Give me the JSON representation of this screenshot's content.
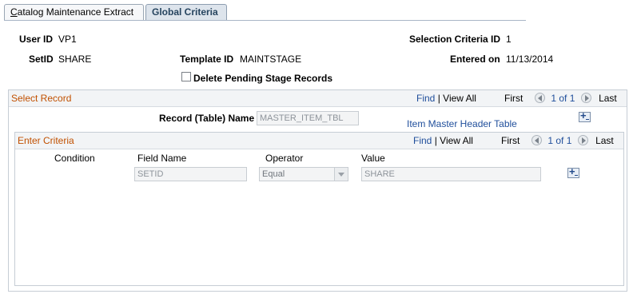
{
  "tabs": [
    {
      "label": "Catalog Maintenance Extract",
      "underline": "C",
      "active": false
    },
    {
      "label": "Global Criteria",
      "active": true
    }
  ],
  "header": {
    "user_id_label": "User ID",
    "user_id_value": "VP1",
    "setid_label": "SetID",
    "setid_value": "SHARE",
    "template_id_label": "Template ID",
    "template_id_value": "MAINTSTAGE",
    "selection_criteria_label": "Selection Criteria ID",
    "selection_criteria_value": "1",
    "entered_on_label": "Entered on",
    "entered_on_value": "11/13/2014",
    "delete_pending_label": "Delete Pending Stage Records",
    "delete_pending_checked": false
  },
  "select_record": {
    "title": "Select Record",
    "find": "Find",
    "sep": "|",
    "view_all": "View All",
    "first": "First",
    "count": "1 of 1",
    "last": "Last",
    "record_label": "Record (Table) Name",
    "record_value": "MASTER_ITEM_TBL",
    "record_description": "Item Master Header Table"
  },
  "enter_criteria": {
    "title": "Enter Criteria",
    "find": "Find",
    "sep": "|",
    "view_all": "View All",
    "first": "First",
    "count": "1 of 1",
    "last": "Last",
    "columns": {
      "condition": "Condition",
      "field_name": "Field Name",
      "operator": "Operator",
      "value": "Value"
    },
    "row": {
      "field_name": "SETID",
      "operator": "Equal",
      "value": "SHARE"
    }
  }
}
